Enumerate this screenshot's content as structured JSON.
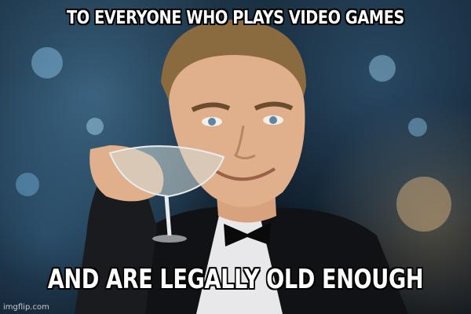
{
  "meme": {
    "top_text": "TO EVERYONE WHO PLAYS VIDEO GAMES",
    "bottom_text": "AND ARE LEGALLY OLD ENOUGH",
    "watermark": "imgflip.com"
  },
  "colors": {
    "caption": "#ffffff",
    "caption_outline": "#000000",
    "background": "#0e1b28"
  }
}
